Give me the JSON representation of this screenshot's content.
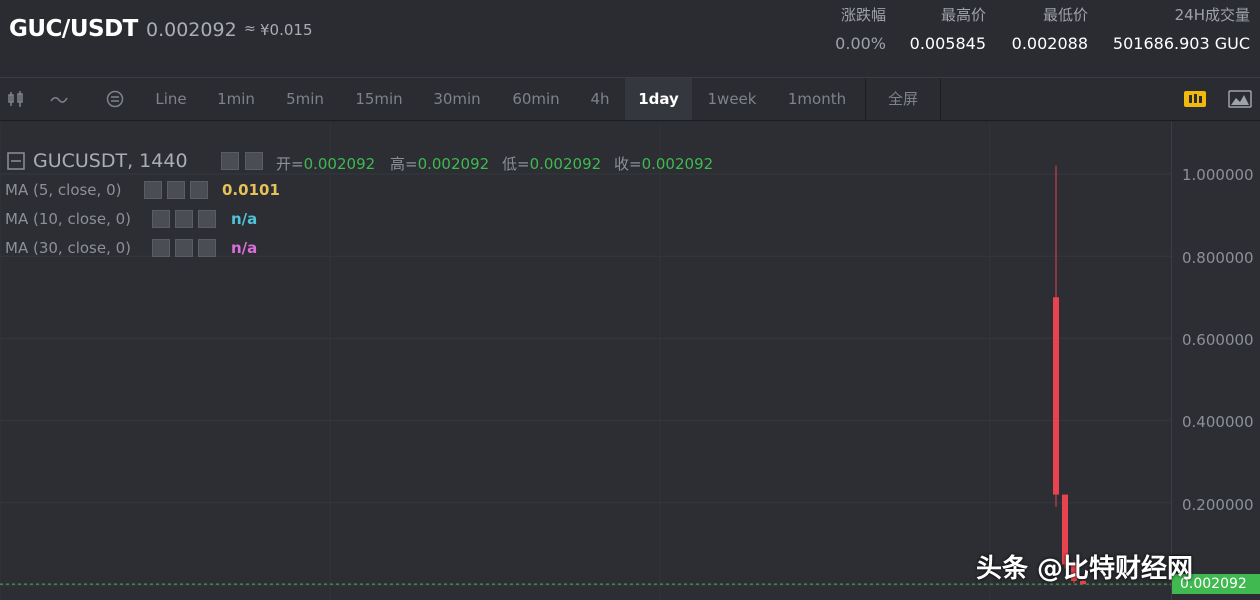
{
  "header": {
    "pair": "GUC/USDT",
    "price": "0.002092",
    "approx": "≈",
    "cny": "¥0.015",
    "stats": [
      {
        "label": "涨跌幅",
        "value": "0.00%"
      },
      {
        "label": "最高价",
        "value": "0.005845"
      },
      {
        "label": "最低价",
        "value": "0.002088"
      },
      {
        "label": "24H成交量",
        "value": "501686.903 GUC"
      }
    ]
  },
  "toolbar": {
    "items": [
      "Line",
      "1min",
      "5min",
      "15min",
      "30min",
      "60min",
      "4h",
      "1day",
      "1week",
      "1month",
      "全屏"
    ],
    "active": "1day"
  },
  "legend": {
    "title": "GUCUSDT, 1440",
    "ohlc": [
      {
        "k": "开=",
        "v": "0.002092"
      },
      {
        "k": "高=",
        "v": "0.002092"
      },
      {
        "k": "低=",
        "v": "0.002092"
      },
      {
        "k": "收=",
        "v": "0.002092"
      }
    ],
    "ma": [
      {
        "label": "MA (5, close, 0)",
        "value": "0.0101",
        "color": "#e6c15a"
      },
      {
        "label": "MA (10, close, 0)",
        "value": "n/a",
        "color": "#4fc3d9"
      },
      {
        "label": "MA (30, close, 0)",
        "value": "n/a",
        "color": "#d96fd9"
      }
    ]
  },
  "yaxis": {
    "ticks": [
      "1.000000",
      "0.800000",
      "0.600000",
      "0.400000",
      "0.200000"
    ],
    "last": "0.002092"
  },
  "watermark": "头条 @比特财经网",
  "chart_data": {
    "type": "candlestick",
    "ylim": [
      0,
      1.1
    ],
    "candles": [
      {
        "open": 0.7,
        "close": 0.22,
        "high": 1.02,
        "low": 0.19
      },
      {
        "open": 0.22,
        "close": 0.05,
        "high": 0.22,
        "low": 0.04
      },
      {
        "open": 0.05,
        "close": 0.01,
        "high": 0.06,
        "low": 0.005
      },
      {
        "open": 0.01,
        "close": 0.002092,
        "high": 0.012,
        "low": 0.002
      }
    ],
    "colors": {
      "up": "#3fb950",
      "down": "#e8434e"
    }
  }
}
